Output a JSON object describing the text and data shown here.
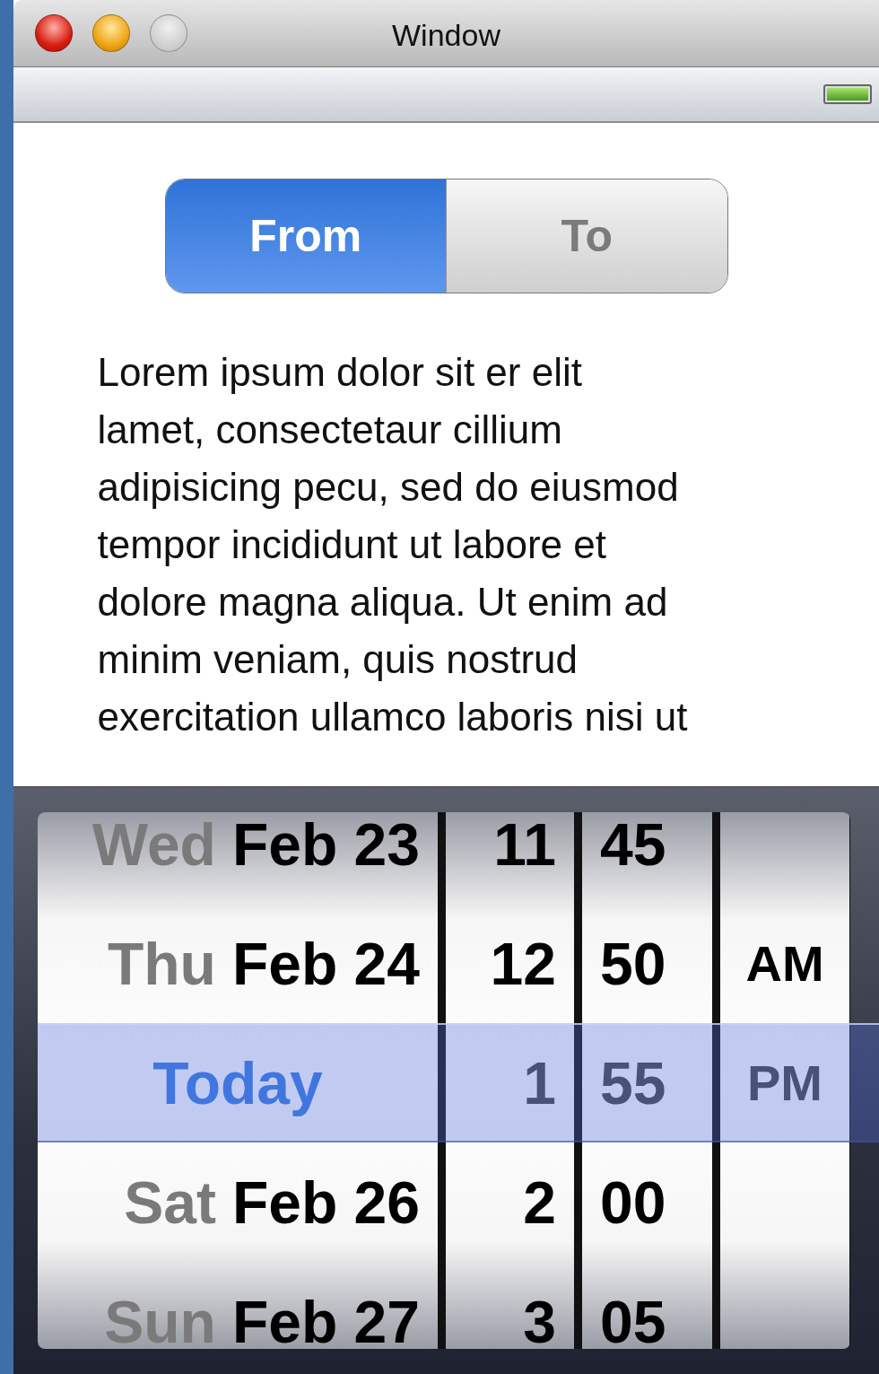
{
  "window": {
    "title": "Window",
    "buttons": [
      {
        "kind": "close",
        "disabled": false
      },
      {
        "kind": "minimize",
        "disabled": false
      },
      {
        "kind": "zoom",
        "disabled": true
      }
    ]
  },
  "status_bar": {
    "battery": {
      "level": 1
    }
  },
  "segments": [
    {
      "label": "From",
      "selected": true
    },
    {
      "label": "To",
      "selected": false
    }
  ],
  "paragraph": {
    "lines": [
      "Lorem ipsum dolor sit er elit",
      "lamet, consectetaur cillium",
      "adipisicing pecu, sed do eiusmod",
      "tempor incididunt ut labore et",
      "dolore magna aliqua. Ut enim ad",
      "minim veniam, quis nostrud",
      "exercitation ullamco laboris nisi ut"
    ]
  },
  "picker": {
    "rows": [
      {
        "kind": "date",
        "day": "Wed",
        "date": "Feb 23",
        "hour": "11",
        "minute": "45",
        "selected": false
      },
      {
        "kind": "date",
        "day": "Thu",
        "date": "Feb 24",
        "hour": "12",
        "minute": "50",
        "period": "AM",
        "selected": false
      },
      {
        "kind": "today",
        "label": "Today",
        "hour": "1",
        "minute": "55",
        "period": "PM",
        "selected": true
      },
      {
        "kind": "date",
        "day": "Sat",
        "date": "Feb 26",
        "hour": "2",
        "minute": "00",
        "selected": false
      },
      {
        "kind": "date",
        "day": "Sun",
        "date": "Feb 27",
        "hour": "3",
        "minute": "05",
        "selected": false
      }
    ]
  }
}
